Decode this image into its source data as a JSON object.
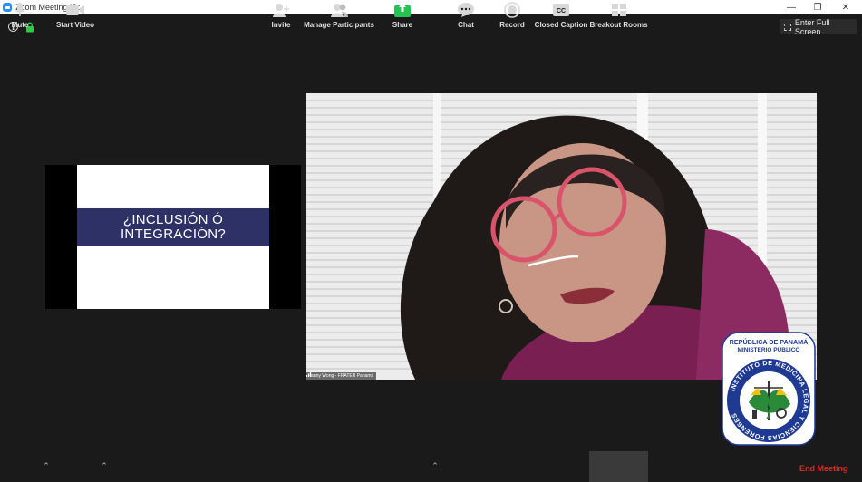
{
  "window": {
    "title": "Zoom Meeting ID:",
    "minimize": "—",
    "restore": "❐",
    "close": "✕"
  },
  "top_bar": {
    "info": "i",
    "fullscreen_label": "Enter Full Screen"
  },
  "slide": {
    "line1": "¿INCLUSIÓN Ó",
    "line2": "INTEGRACIÓN?",
    "band_color": "#2d3165"
  },
  "video": {
    "participant_name": "Fanny Wong - FRATER Panamá"
  },
  "seal": {
    "top_line1": "REPÚBLICA DE PANAMÁ",
    "top_line2": "MINISTERIO PÚBLICO",
    "ring_text": "INSTITUTO DE MEDICINA LEGAL Y CIENCIAS FORENSES",
    "ring_color": "#1f3a93"
  },
  "toolbar": {
    "mute": "Mute",
    "start_video": "Start Video",
    "invite": "Invite",
    "manage_participants": "Manage Participants",
    "share": "Share",
    "chat": "Chat",
    "record": "Record",
    "closed_caption": "Closed Caption",
    "cc_icon_text": "CC",
    "breakout_rooms": "Breakout Rooms",
    "end_meeting": "End Meeting",
    "share_color": "#23c552",
    "end_color": "#e02828"
  }
}
